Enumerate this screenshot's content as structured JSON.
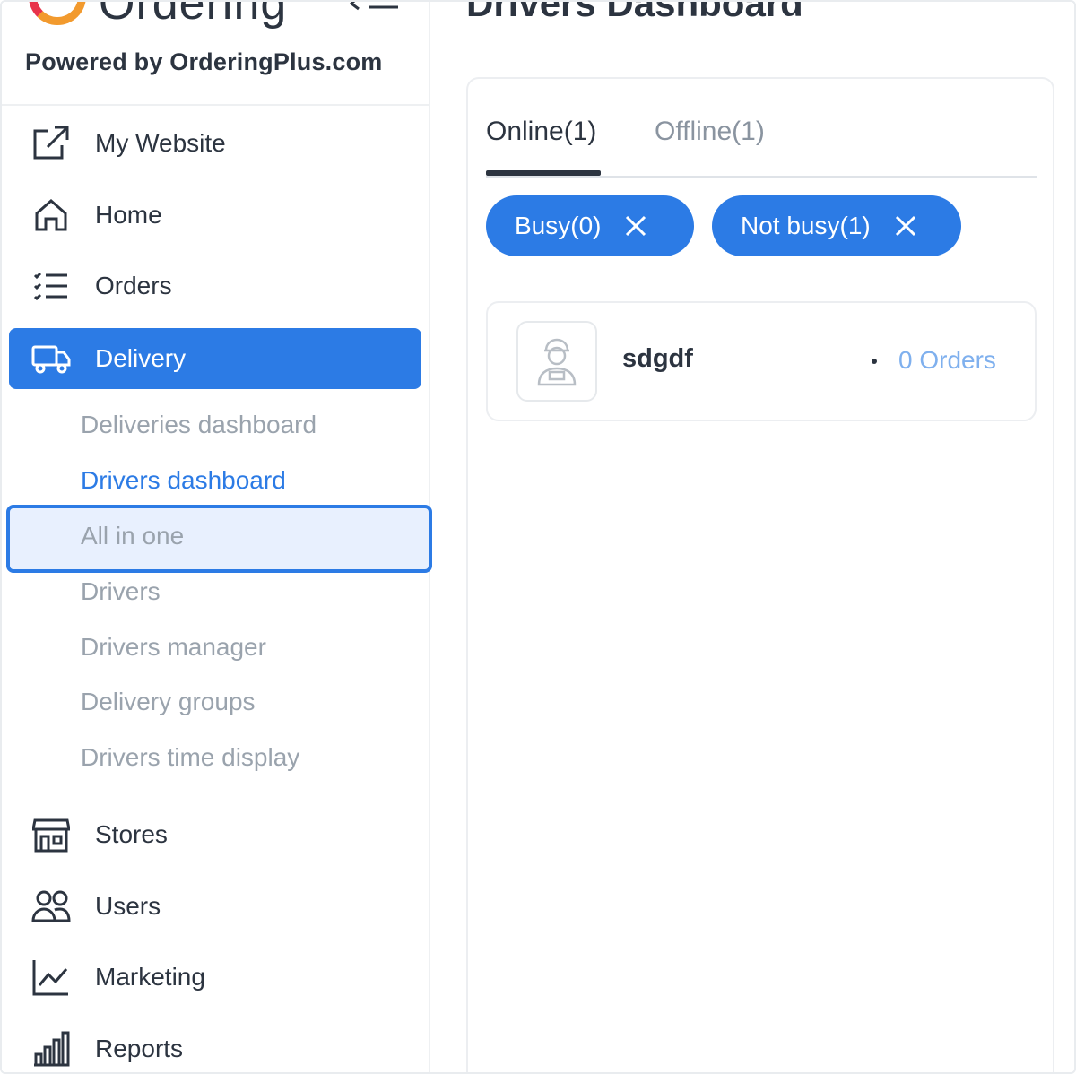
{
  "brand": {
    "logo_word": "Ordering",
    "powered_by": "Powered by OrderingPlus.com"
  },
  "sidebar": {
    "items": [
      {
        "label": "My Website",
        "icon": "external-link-icon"
      },
      {
        "label": "Home",
        "icon": "home-icon"
      },
      {
        "label": "Orders",
        "icon": "list-check-icon"
      },
      {
        "label": "Delivery",
        "icon": "truck-icon",
        "active": true
      },
      {
        "label": "Stores",
        "icon": "storefront-icon"
      },
      {
        "label": "Users",
        "icon": "users-icon"
      },
      {
        "label": "Marketing",
        "icon": "graph-up-icon"
      },
      {
        "label": "Reports",
        "icon": "bar-chart-icon"
      }
    ],
    "delivery_subitems": [
      {
        "label": "Deliveries dashboard"
      },
      {
        "label": "Drivers dashboard",
        "current": true
      },
      {
        "label": "All in one",
        "highlighted": true
      },
      {
        "label": "Drivers"
      },
      {
        "label": "Drivers manager"
      },
      {
        "label": "Delivery groups"
      },
      {
        "label": "Drivers time display"
      }
    ]
  },
  "main": {
    "title": "Drivers Dashboard",
    "tabs": [
      {
        "label": "Online(1)",
        "active": true
      },
      {
        "label": "Offline(1)",
        "active": false
      }
    ],
    "filters": [
      {
        "label": "Busy(0)"
      },
      {
        "label": "Not busy(1)"
      }
    ],
    "drivers": [
      {
        "name": "sdgdf",
        "orders": "0 Orders"
      }
    ]
  },
  "colors": {
    "accent": "#2c7be5",
    "text_dark": "#2c3440",
    "text_muted": "#9aa3ad",
    "highlight_bg": "#e8f0fe",
    "orders_link": "#7fb0ee"
  }
}
